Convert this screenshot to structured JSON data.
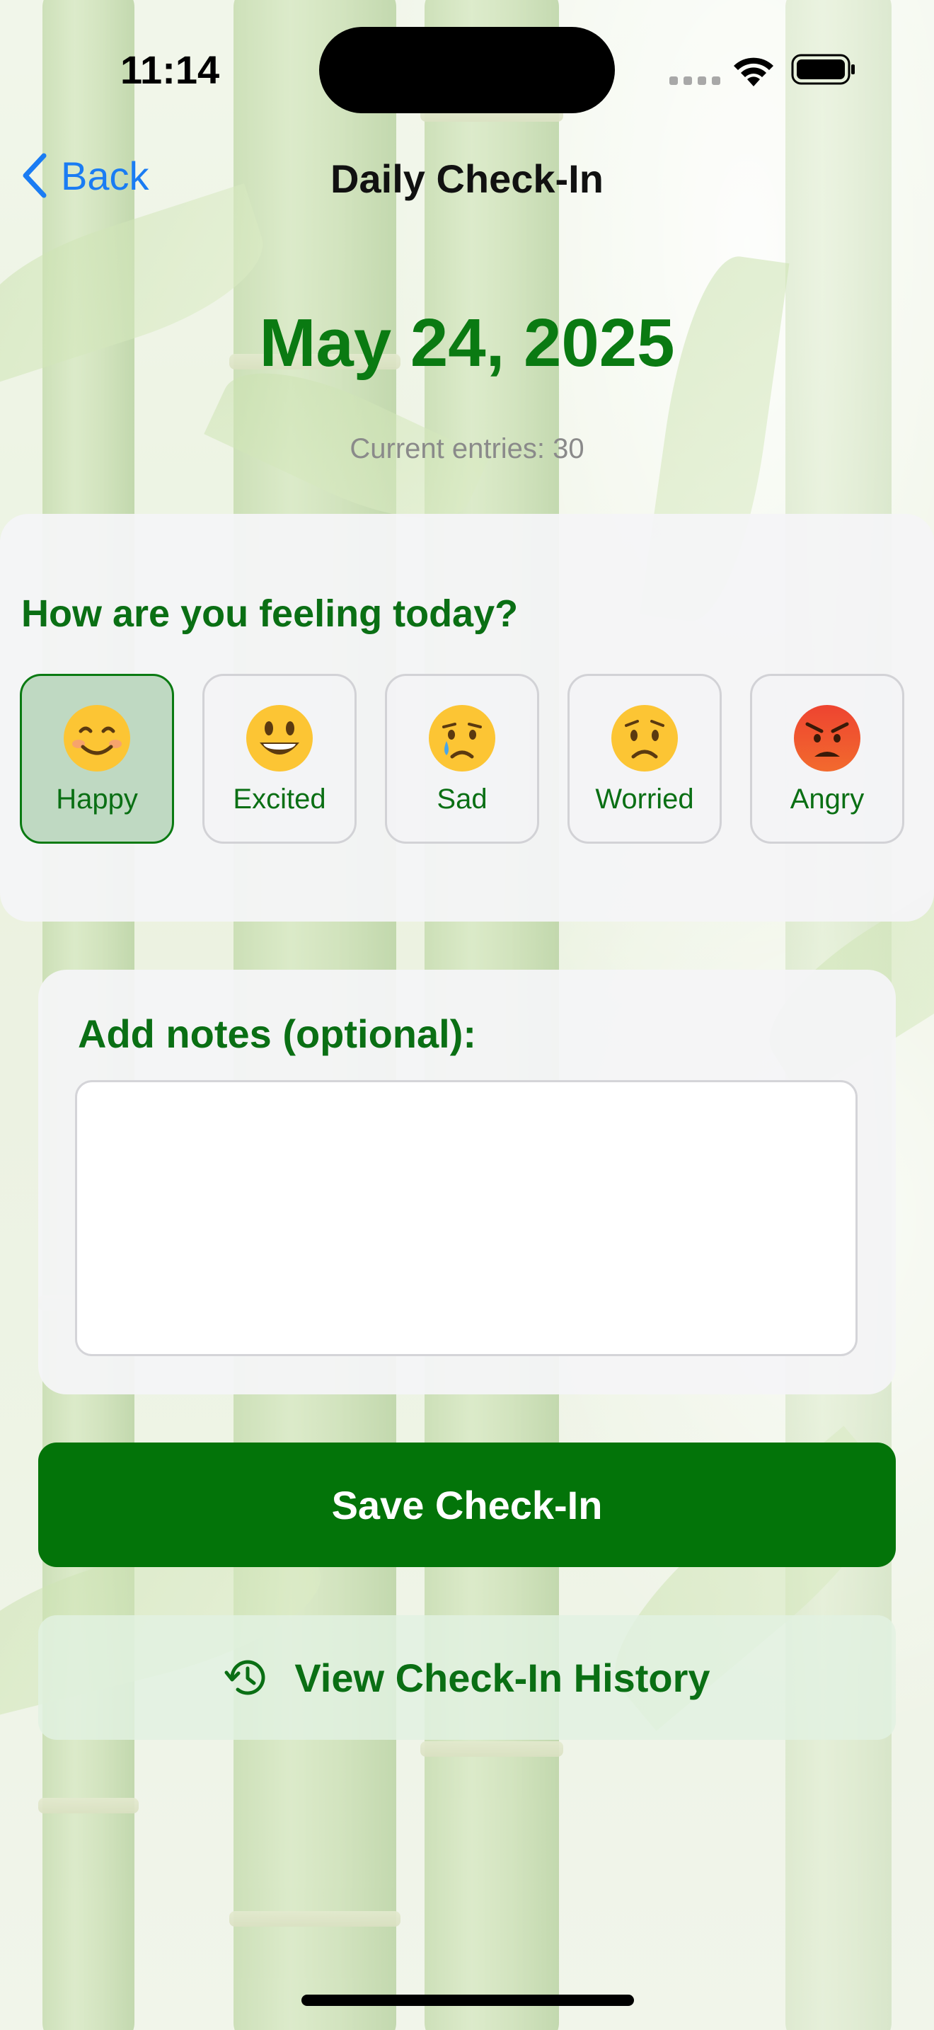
{
  "status_bar": {
    "time": "11:14"
  },
  "nav": {
    "back_label": "Back",
    "title": "Daily Check-In"
  },
  "header": {
    "date": "May 24, 2025",
    "entries": "Current entries: 30"
  },
  "mood": {
    "question": "How are you feeling today?",
    "selected": "Happy",
    "options": [
      {
        "label": "Happy",
        "icon": "smiling-face-icon"
      },
      {
        "label": "Excited",
        "icon": "grinning-face-icon"
      },
      {
        "label": "Sad",
        "icon": "crying-face-icon"
      },
      {
        "label": "Worried",
        "icon": "worried-face-icon"
      },
      {
        "label": "Angry",
        "icon": "angry-face-icon"
      }
    ]
  },
  "notes": {
    "label": "Add notes (optional):",
    "value": ""
  },
  "actions": {
    "save_label": "Save Check-In",
    "history_label": "View Check-In History"
  },
  "colors": {
    "accent_green": "#037409",
    "link_blue": "#1a7cf3"
  }
}
